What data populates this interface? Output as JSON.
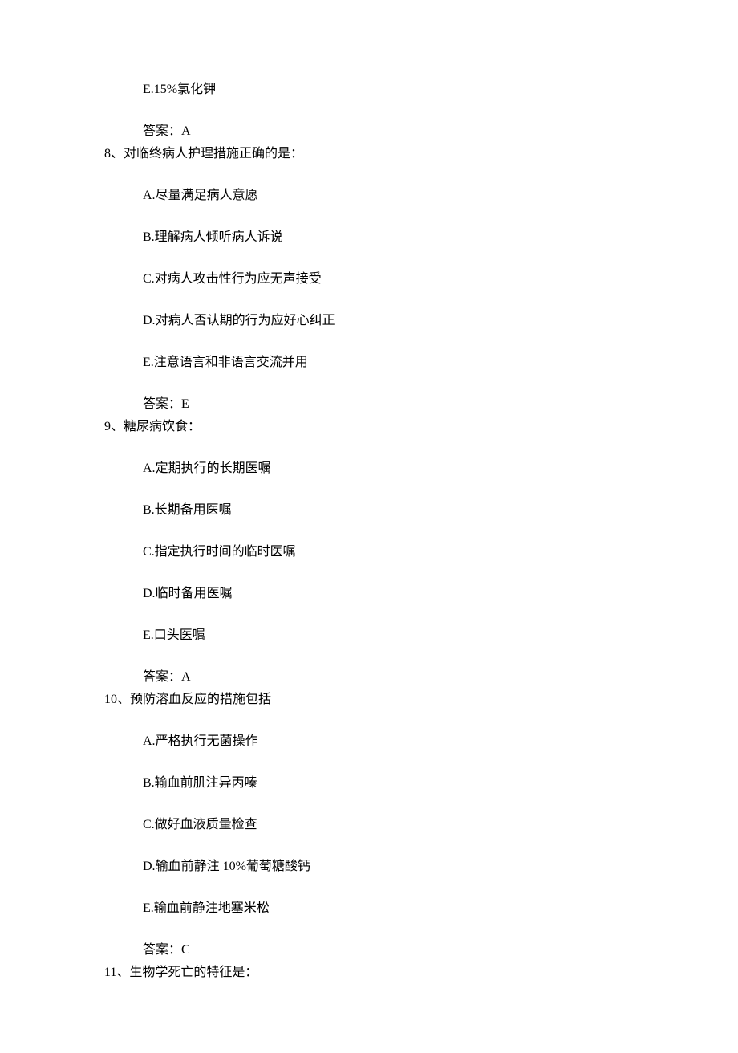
{
  "orphan_option": {
    "label": "E.",
    "text": "15%氯化钾"
  },
  "orphan_answer": {
    "prefix": "答案：",
    "value": "A"
  },
  "questions": [
    {
      "number": "8、",
      "text": "对临终病人护理措施正确的是：",
      "options": [
        {
          "label": "A.",
          "text": "尽量满足病人意愿"
        },
        {
          "label": "B.",
          "text": "理解病人倾听病人诉说"
        },
        {
          "label": "C.",
          "text": "对病人攻击性行为应无声接受"
        },
        {
          "label": "D.",
          "text": "对病人否认期的行为应好心纠正"
        },
        {
          "label": "E.",
          "text": "注意语言和非语言交流并用"
        }
      ],
      "answer": {
        "prefix": "答案：",
        "value": "E"
      }
    },
    {
      "number": "9、",
      "text": "糖尿病饮食：",
      "options": [
        {
          "label": "A.",
          "text": "定期执行的长期医嘱"
        },
        {
          "label": "B.",
          "text": "长期备用医嘱"
        },
        {
          "label": "C.",
          "text": "指定执行时间的临时医嘱"
        },
        {
          "label": "D.",
          "text": "临时备用医嘱"
        },
        {
          "label": "E.",
          "text": "口头医嘱"
        }
      ],
      "answer": {
        "prefix": "答案：",
        "value": "A"
      }
    },
    {
      "number": "10、",
      "text": "预防溶血反应的措施包括",
      "options": [
        {
          "label": "A.",
          "text": "严格执行无菌操作"
        },
        {
          "label": "B.",
          "text": "输血前肌注异丙嗪"
        },
        {
          "label": "C.",
          "text": "做好血液质量检查"
        },
        {
          "label": "D.",
          "text": "输血前静注 10%葡萄糖酸钙"
        },
        {
          "label": "E.",
          "text": "输血前静注地塞米松"
        }
      ],
      "answer": {
        "prefix": "答案：",
        "value": "C"
      }
    },
    {
      "number": "11、",
      "text": "生物学死亡的特征是：",
      "options": [],
      "answer": null
    }
  ]
}
